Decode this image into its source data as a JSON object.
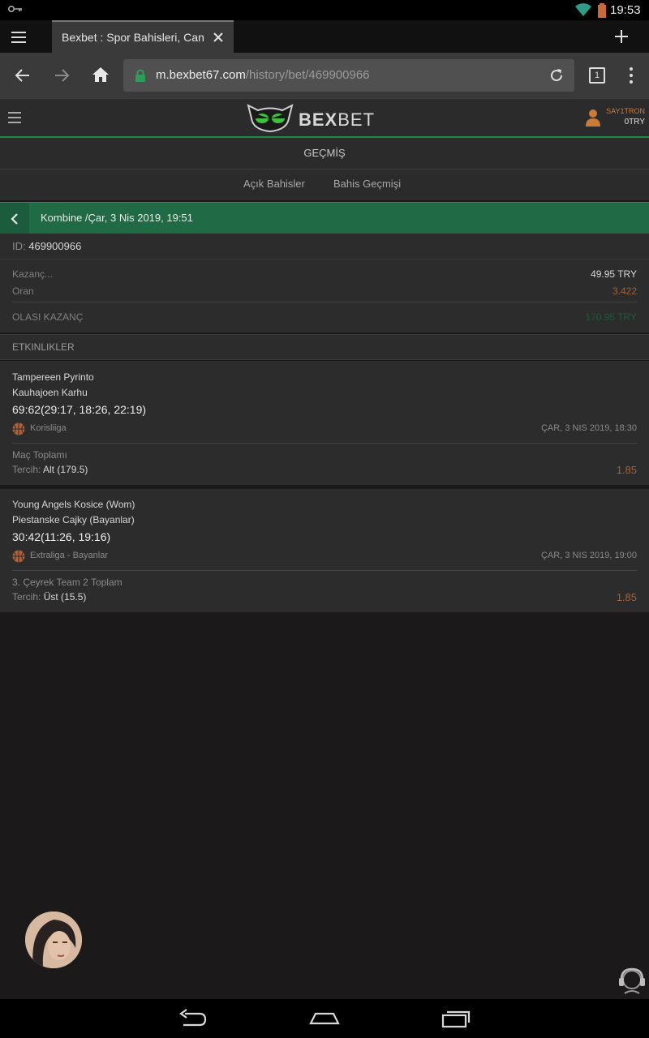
{
  "status_bar": {
    "time": "19:53",
    "icons": [
      "key-icon",
      "wifi-icon",
      "battery-icon"
    ]
  },
  "browser": {
    "tab_title": "Bexbet : Spor Bahisleri, Canl",
    "url_host": "m.bexbet67.com",
    "url_path": "/history/bet/469900966",
    "tab_count": "1"
  },
  "site": {
    "logo_bold": "BEX",
    "logo_light": "BET",
    "username": "SAY1TRON",
    "balance": "0TRY",
    "accent_color": "#206a45",
    "odds_color": "#a0623a"
  },
  "page": {
    "section_title": "GEÇMİŞ",
    "subtabs": [
      "Açık Bahisler",
      "Bahis Geçmişi"
    ]
  },
  "bet": {
    "header": "Kombine /Çar, 3 Nis 2019, 19:51",
    "id_label": "ID:",
    "id_value": "469900966",
    "stake_label": "Kazanç...",
    "stake_value": "49.95 TRY",
    "odds_label": "Oran",
    "odds_value": "3.422",
    "potential_label": "OLASI KAZANÇ",
    "potential_value": "170.95 TRY",
    "events_title": "ETKINLIKLER",
    "events": [
      {
        "team1": "Tampereen Pyrinto",
        "team2": "Kauhajoen Karhu",
        "score": "69:62(29:17, 18:26, 22:19)",
        "league": "Korisliiga",
        "date": "ÇAR, 3 NIS 2019, 18:30",
        "market": "Maç Toplamı",
        "pick_label": "Tercih:",
        "pick_value": "Alt (179.5)",
        "odd": "1.85"
      },
      {
        "team1": "Young Angels Kosice (Wom)",
        "team2": "Piestanske Cajky (Bayanlar)",
        "score": "30:42(11:26, 19:16)",
        "league": "Extraliga - Bayanlar",
        "date": "ÇAR, 3 NIS 2019, 19:00",
        "market": "3. Çeyrek Team 2 Toplam",
        "pick_label": "Tercih:",
        "pick_value": "Üst (15.5)",
        "odd": "1.85"
      }
    ]
  }
}
